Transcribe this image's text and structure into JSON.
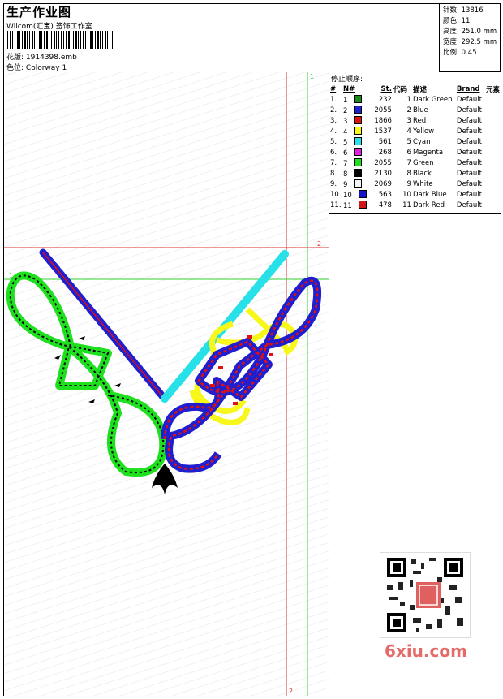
{
  "header": {
    "title": "生产作业图",
    "company": "Wilcom(汇宝) 签饰工作室",
    "design_label": "花版:",
    "design_value": "1914398.emb",
    "colorway_label": "色位:",
    "colorway_value": "Colorway 1"
  },
  "stats": {
    "stitches_label": "针数:",
    "stitches_value": "13816",
    "colors_label": "颜色:",
    "colors_value": "11",
    "height_label": "高度:",
    "height_value": "251.0 mm",
    "width_label": "宽度:",
    "width_value": "292.5 mm",
    "scale_label": "比例:",
    "scale_value": "0.45"
  },
  "stop_sequence": {
    "title": "停止顺序:",
    "columns": [
      "#",
      "N#",
      "St.",
      "代码",
      "描述",
      "Brand",
      "元素"
    ],
    "rows": [
      {
        "idx": "1.",
        "n": "1",
        "color": "#1a8a1a",
        "st": "232",
        "code": "1",
        "desc": "Dark Green",
        "brand": "Default"
      },
      {
        "idx": "2.",
        "n": "2",
        "color": "#1f1fd0",
        "st": "2055",
        "code": "2",
        "desc": "Blue",
        "brand": "Default"
      },
      {
        "idx": "3.",
        "n": "3",
        "color": "#e01010",
        "st": "1866",
        "code": "3",
        "desc": "Red",
        "brand": "Default"
      },
      {
        "idx": "4.",
        "n": "4",
        "color": "#f7f71a",
        "st": "1537",
        "code": "4",
        "desc": "Yellow",
        "brand": "Default"
      },
      {
        "idx": "5.",
        "n": "5",
        "color": "#28e0e8",
        "st": "561",
        "code": "5",
        "desc": "Cyan",
        "brand": "Default"
      },
      {
        "idx": "6.",
        "n": "6",
        "color": "#e020e0",
        "st": "268",
        "code": "6",
        "desc": "Magenta",
        "brand": "Default"
      },
      {
        "idx": "7.",
        "n": "7",
        "color": "#1ee01e",
        "st": "2055",
        "code": "7",
        "desc": "Green",
        "brand": "Default"
      },
      {
        "idx": "8.",
        "n": "8",
        "color": "#000000",
        "st": "2130",
        "code": "8",
        "desc": "Black",
        "brand": "Default"
      },
      {
        "idx": "9.",
        "n": "9",
        "color": "#f4f4f4",
        "st": "2069",
        "code": "9",
        "desc": "White",
        "brand": "Default"
      },
      {
        "idx": "10.",
        "n": "10",
        "color": "#1414c8",
        "st": "563",
        "code": "10",
        "desc": "Dark Blue",
        "brand": "Default"
      },
      {
        "idx": "11.",
        "n": "11",
        "color": "#d01818",
        "st": "478",
        "code": "11",
        "desc": "Dark Red",
        "brand": "Default"
      }
    ]
  },
  "guides": {
    "green_label": "1",
    "red_label": "2"
  },
  "watermark": {
    "text": "6xiu.com"
  },
  "palette": {
    "guide_red": "#e03030",
    "guide_green": "#30d030"
  }
}
